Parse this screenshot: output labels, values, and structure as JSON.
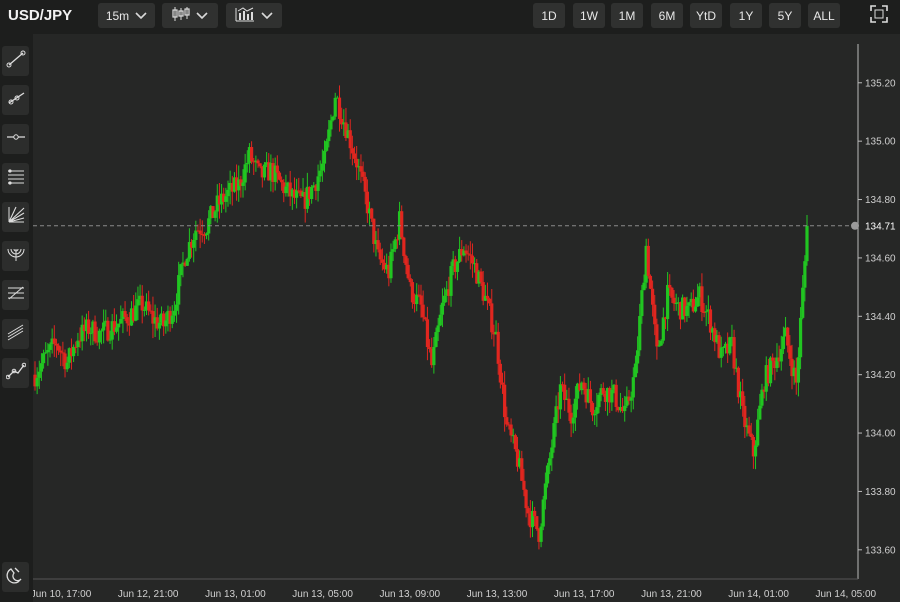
{
  "toolbar": {
    "symbol": "USD/JPY",
    "interval_label": "15m",
    "chart_type_icon": "candlestick-icon",
    "indicator_icon": "studies-icon",
    "ranges": [
      "1D",
      "1W",
      "1M",
      "6M",
      "YtD",
      "1Y",
      "5Y",
      "ALL"
    ],
    "fullscreen_icon": "fullscreen-icon"
  },
  "left_tools": [
    {
      "name": "trend-line-tool",
      "icon": "line-icon"
    },
    {
      "name": "ray-tool",
      "icon": "ray-icon"
    },
    {
      "name": "horizontal-line-tool",
      "icon": "horizontal-line-icon"
    },
    {
      "name": "channel-tool",
      "icon": "channel-icon"
    },
    {
      "name": "fan-tool",
      "icon": "fan-icon"
    },
    {
      "name": "arc-tool",
      "icon": "arc-icon"
    },
    {
      "name": "retracement-tool",
      "icon": "retracement-icon"
    },
    {
      "name": "parallel-channel-tool",
      "icon": "parallel-lines-icon"
    },
    {
      "name": "polyline-tool",
      "icon": "polyline-icon"
    },
    {
      "name": "magnet-tool",
      "icon": "magnet-icon"
    }
  ],
  "chart_data": {
    "type": "candlestick",
    "ylim": [
      133.5,
      135.35
    ],
    "price_ticks": [
      "135.20",
      "135.00",
      "134.80",
      "134.60",
      "134.40",
      "134.20",
      "134.00",
      "133.80",
      "133.60"
    ],
    "last_price": 134.71,
    "last_price_label": "134.71",
    "time_labels": [
      "Jun 10, 17:00",
      "Jun 12, 21:00",
      "Jun 13, 01:00",
      "Jun 13, 05:00",
      "Jun 13, 09:00",
      "Jun 13, 13:00",
      "Jun 13, 17:00",
      "Jun 13, 21:00",
      "Jun 14, 01:00",
      "Jun 14, 05:00"
    ],
    "up_color": "#21c521",
    "down_color": "#e0261f",
    "close_path": [
      134.2,
      134.26,
      134.31,
      134.24,
      134.33,
      134.36,
      134.34,
      134.36,
      134.38,
      134.41,
      134.44,
      134.39,
      134.37,
      134.44,
      134.61,
      134.7,
      134.71,
      134.78,
      134.82,
      134.85,
      134.95,
      134.88,
      134.9,
      134.85,
      134.81,
      134.79,
      134.85,
      134.93,
      135.16,
      135.05,
      134.93,
      134.78,
      134.6,
      134.55,
      134.73,
      134.49,
      134.43,
      134.23,
      134.43,
      134.56,
      134.64,
      134.57,
      134.46,
      134.33,
      134.02,
      133.91,
      133.73,
      133.66,
      133.91,
      134.15,
      134.07,
      134.18,
      134.09,
      134.15,
      134.13,
      134.06,
      134.21,
      134.64,
      134.27,
      134.47,
      134.43,
      134.42,
      134.47,
      134.38,
      134.26,
      134.3,
      134.06,
      133.93,
      134.18,
      134.25,
      134.33,
      134.17,
      134.69
    ]
  }
}
